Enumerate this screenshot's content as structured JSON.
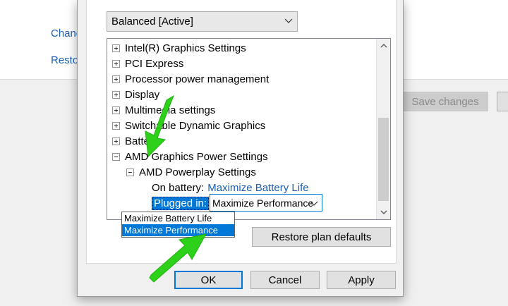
{
  "background": {
    "link_change": "Chang",
    "link_restore": "Resto",
    "save_changes": "Save changes"
  },
  "dialog": {
    "plan_select": "Balanced [Active]",
    "tree": {
      "items": [
        {
          "label": "Intel(R) Graphics Settings"
        },
        {
          "label": "PCI Express"
        },
        {
          "label": "Processor power management"
        },
        {
          "label": "Display"
        },
        {
          "label": "Multimedia settings"
        },
        {
          "label": "Switchable Dynamic Graphics"
        },
        {
          "label": "Battery"
        },
        {
          "label": "AMD Graphics Power Settings"
        },
        {
          "label": "AMD Powerplay Settings"
        }
      ],
      "on_battery_label": "On battery:",
      "on_battery_value": "Maximize Battery Life",
      "plugged_in_label": "Plugged in:",
      "plugged_in_value": "Maximize Performance"
    },
    "dropdown_options": [
      "Maximize Battery Life",
      "Maximize Performance"
    ],
    "dropdown_selected": "Maximize Performance",
    "restore_defaults": "Restore plan defaults",
    "ok": "OK",
    "cancel": "Cancel",
    "apply": "Apply"
  },
  "colors": {
    "accent": "#0078d7",
    "link": "#1a5fb4",
    "arrow": "#2ed11a"
  },
  "icons": [
    "plus-expander-icon",
    "minus-expander-icon",
    "chevron-down-icon",
    "scroll-up-icon",
    "scroll-down-icon",
    "green-arrow-icon"
  ]
}
